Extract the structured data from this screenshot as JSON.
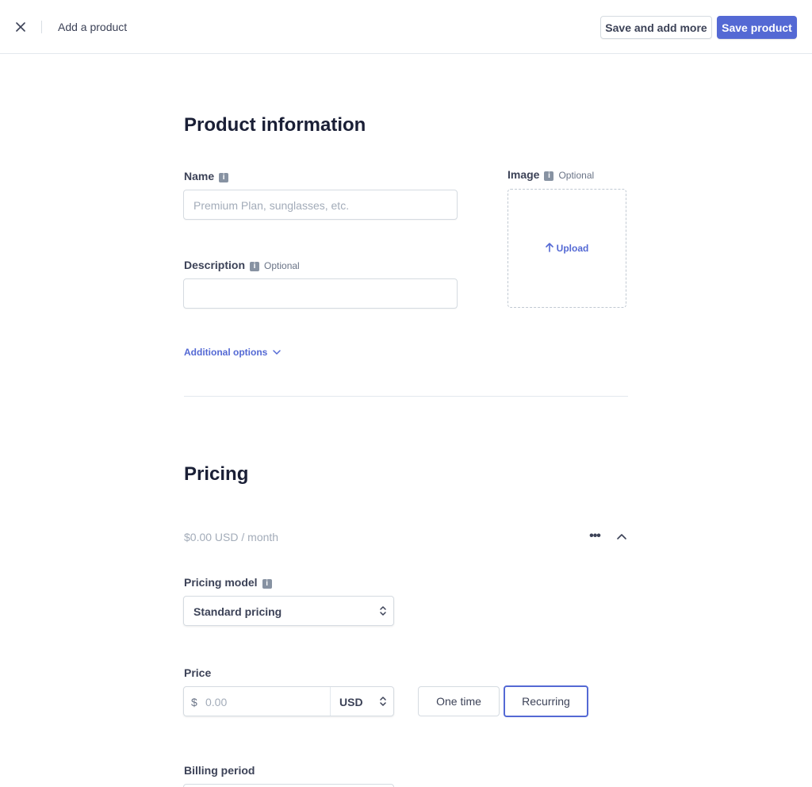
{
  "topbar": {
    "title": "Add a product",
    "save_and_add_more": "Save and add more",
    "save_product": "Save product"
  },
  "product_info": {
    "heading": "Product information",
    "name_label": "Name",
    "name_placeholder": "Premium Plan, sunglasses, etc.",
    "description_label": "Description",
    "optional": "Optional",
    "image_label": "Image",
    "upload_label": "Upload",
    "additional_options": "Additional options"
  },
  "pricing": {
    "heading": "Pricing",
    "summary": "$0.00 USD / month",
    "model_label": "Pricing model",
    "model_value": "Standard pricing",
    "price_label": "Price",
    "currency_symbol": "$",
    "price_placeholder": "0.00",
    "currency": "USD",
    "one_time": "One time",
    "recurring": "Recurring",
    "billing_period_label": "Billing period"
  },
  "colors": {
    "accent": "#5469d4",
    "text": "#3c4257",
    "muted": "#a3acb9",
    "border": "#d5dbe1"
  },
  "icons": [
    "close-icon",
    "info-icon",
    "arrow-up-icon",
    "chevron-down-icon",
    "more-icon",
    "chevron-up-icon",
    "updown-chevron-icon"
  ]
}
